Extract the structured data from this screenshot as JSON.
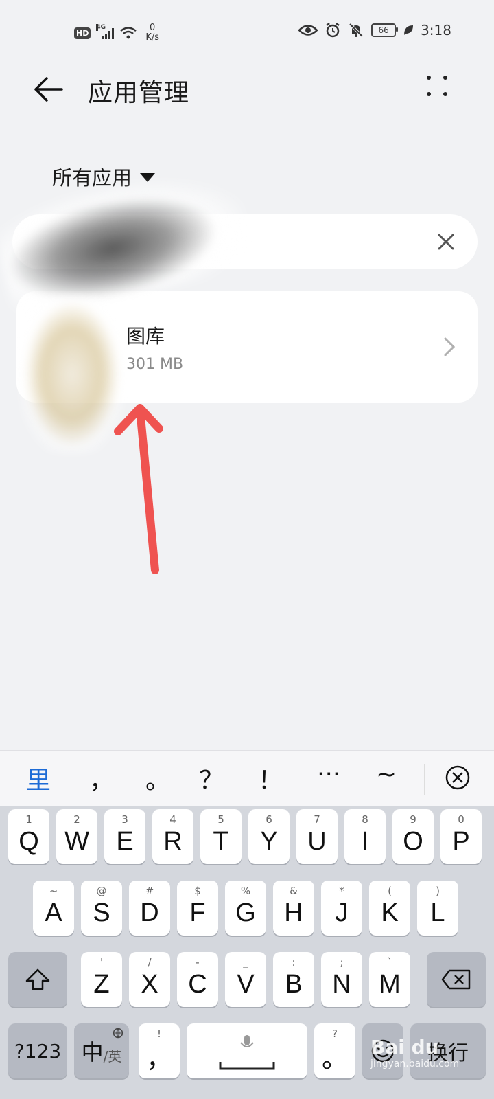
{
  "status_bar": {
    "hd": "HD",
    "net": "4G",
    "speed_value": "0",
    "speed_unit": "K/s",
    "battery": "66",
    "time": "3:18"
  },
  "header": {
    "title": "应用管理"
  },
  "filter": {
    "label": "所有应用"
  },
  "search": {
    "value": "",
    "placeholder": ""
  },
  "app": {
    "name": "图库",
    "size": "301 MB"
  },
  "keyboard": {
    "candidates": [
      "里",
      "，",
      "。",
      "？",
      "！",
      "···",
      "~"
    ],
    "row1": [
      {
        "main": "Q",
        "sub": "1"
      },
      {
        "main": "W",
        "sub": "2"
      },
      {
        "main": "E",
        "sub": "3"
      },
      {
        "main": "R",
        "sub": "4"
      },
      {
        "main": "T",
        "sub": "5"
      },
      {
        "main": "Y",
        "sub": "6"
      },
      {
        "main": "U",
        "sub": "7"
      },
      {
        "main": "I",
        "sub": "8"
      },
      {
        "main": "O",
        "sub": "9"
      },
      {
        "main": "P",
        "sub": "0"
      }
    ],
    "row2": [
      {
        "main": "A",
        "sub": "~"
      },
      {
        "main": "S",
        "sub": "@"
      },
      {
        "main": "D",
        "sub": "#"
      },
      {
        "main": "F",
        "sub": "$"
      },
      {
        "main": "G",
        "sub": "%"
      },
      {
        "main": "H",
        "sub": "&"
      },
      {
        "main": "J",
        "sub": "*"
      },
      {
        "main": "K",
        "sub": "("
      },
      {
        "main": "L",
        "sub": ")"
      }
    ],
    "row3": [
      {
        "main": "Z",
        "sub": "'"
      },
      {
        "main": "X",
        "sub": "/"
      },
      {
        "main": "C",
        "sub": "-"
      },
      {
        "main": "V",
        "sub": "_"
      },
      {
        "main": "B",
        "sub": ":"
      },
      {
        "main": "N",
        "sub": ";"
      },
      {
        "main": "M",
        "sub": "`"
      }
    ],
    "num_label": "?123",
    "lang_main": "中",
    "lang_sub": "/英",
    "comma_main": "，",
    "comma_sub": "!",
    "period_main": "。",
    "period_sub": "?",
    "enter_label": "换行"
  },
  "watermark": {
    "brand": "Bai du",
    "site": "jingyan.baidu.com"
  },
  "colors": {
    "accent": "#1d6bd6",
    "arrow": "#ef5350"
  }
}
